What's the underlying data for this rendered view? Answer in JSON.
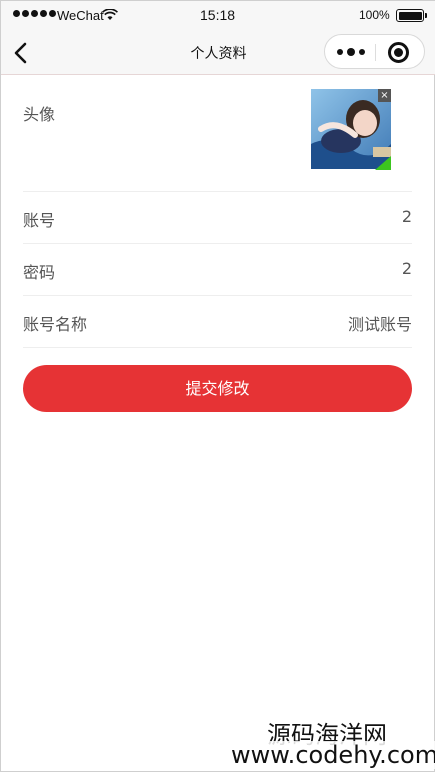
{
  "status_bar": {
    "carrier": "WeChat",
    "time": "15:18",
    "battery": "100%"
  },
  "nav": {
    "title": "个人资料",
    "icons": [
      "back-icon",
      "more-icon",
      "target-icon"
    ]
  },
  "profile": {
    "avatar_label": "头像",
    "avatar_remove_glyph": "×",
    "rows": [
      {
        "label": "账号",
        "value": "2"
      },
      {
        "label": "密码",
        "value": "2"
      },
      {
        "label": "账号名称",
        "value": "测试账号"
      }
    ]
  },
  "submit_label": "提交修改",
  "watermark": {
    "line1": "源码海洋网",
    "line2": "www.codehy.com"
  },
  "colors": {
    "accent": "#e63335",
    "check": "#3cc51f"
  }
}
